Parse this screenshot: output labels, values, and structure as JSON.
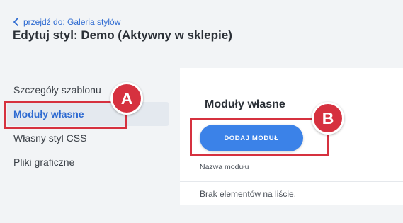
{
  "header": {
    "back_link_label": "przejdź do: Galeria stylów",
    "page_title": "Edytuj styl: Demo (Aktywny w sklepie)"
  },
  "sidebar": {
    "items": [
      {
        "label": "Szczegóły szablonu",
        "active": false
      },
      {
        "label": "Moduły własne",
        "active": true
      },
      {
        "label": "Własny styl CSS",
        "active": false
      },
      {
        "label": "Pliki graficzne",
        "active": false
      }
    ]
  },
  "main": {
    "section_title": "Moduły własne",
    "add_button_label": "DODAJ MODUŁ",
    "column_header": "Nazwa modułu",
    "empty_message": "Brak elementów na liście."
  },
  "annotations": {
    "a": "A",
    "b": "B"
  },
  "colors": {
    "accent": "#2d6ad1",
    "button": "#3b82e8",
    "callout": "#d6313f"
  }
}
